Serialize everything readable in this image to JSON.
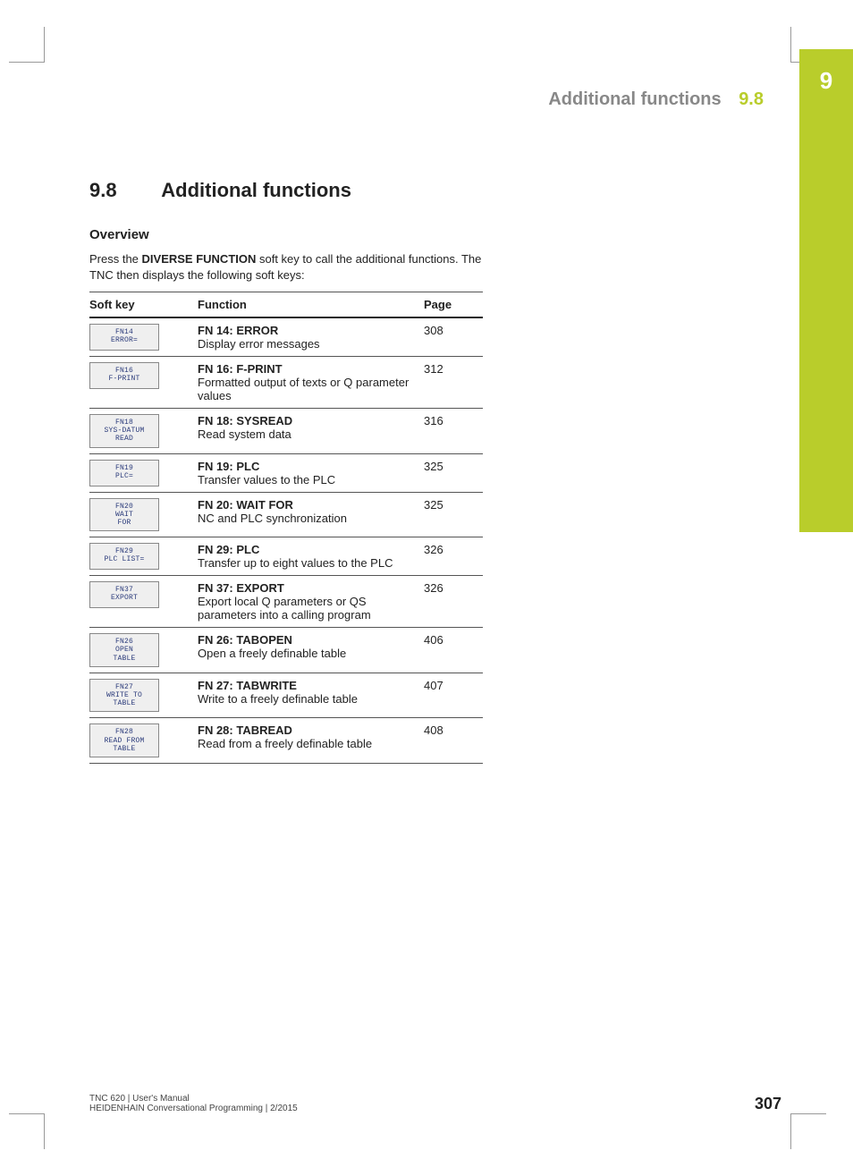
{
  "chapter_tab": "9",
  "running_head": {
    "title": "Additional functions",
    "section": "9.8"
  },
  "heading": {
    "number": "9.8",
    "text": "Additional functions"
  },
  "overview_label": "Overview",
  "intro_pre": "Press the ",
  "intro_bold": "DIVERSE FUNCTION",
  "intro_post": " soft key to call the additional functions. The TNC then displays the following soft keys:",
  "table": {
    "headers": {
      "softkey": "Soft key",
      "function": "Function",
      "page": "Page"
    },
    "rows": [
      {
        "key_l1": "FN14",
        "key_l2": "ERROR=",
        "key_l3": "",
        "title": "FN 14: ERROR",
        "desc": "Display error messages",
        "page": "308"
      },
      {
        "key_l1": "FN16",
        "key_l2": "F-PRINT",
        "key_l3": "",
        "title": "FN 16: F-PRINT",
        "desc": "Formatted output of texts or Q parameter values",
        "page": "312"
      },
      {
        "key_l1": "FN18",
        "key_l2": "SYS-DATUM",
        "key_l3": "READ",
        "title": "FN 18: SYSREAD",
        "desc": "Read system data",
        "page": "316"
      },
      {
        "key_l1": "FN19",
        "key_l2": "PLC=",
        "key_l3": "",
        "title": "FN 19: PLC",
        "desc": "Transfer values to the PLC",
        "page": "325"
      },
      {
        "key_l1": "FN20",
        "key_l2": "WAIT",
        "key_l3": "FOR",
        "title": "FN 20: WAIT FOR",
        "desc": "NC and PLC synchronization",
        "page": "325"
      },
      {
        "key_l1": "FN29",
        "key_l2": "PLC LIST=",
        "key_l3": "",
        "title": "FN 29: PLC",
        "desc": "Transfer up to eight values to the PLC",
        "page": "326"
      },
      {
        "key_l1": "FN37",
        "key_l2": "EXPORT",
        "key_l3": "",
        "title": "FN 37: EXPORT",
        "desc": "Export local Q parameters or QS parameters into a calling program",
        "page": "326"
      },
      {
        "key_l1": "FN26",
        "key_l2": "OPEN",
        "key_l3": "TABLE",
        "title": "FN 26: TABOPEN",
        "desc": "Open a freely definable table",
        "page": "406"
      },
      {
        "key_l1": "FN27",
        "key_l2": "WRITE TO",
        "key_l3": "TABLE",
        "title": "FN 27: TABWRITE",
        "desc": "Write to a freely definable table",
        "page": "407"
      },
      {
        "key_l1": "FN28",
        "key_l2": "READ FROM",
        "key_l3": "TABLE",
        "title": "FN 28: TABREAD",
        "desc": "Read from a freely definable table",
        "page": "408"
      }
    ]
  },
  "footer": {
    "line1": "TNC 620 | User's Manual",
    "line2": "HEIDENHAIN Conversational Programming | 2/2015",
    "page": "307"
  }
}
